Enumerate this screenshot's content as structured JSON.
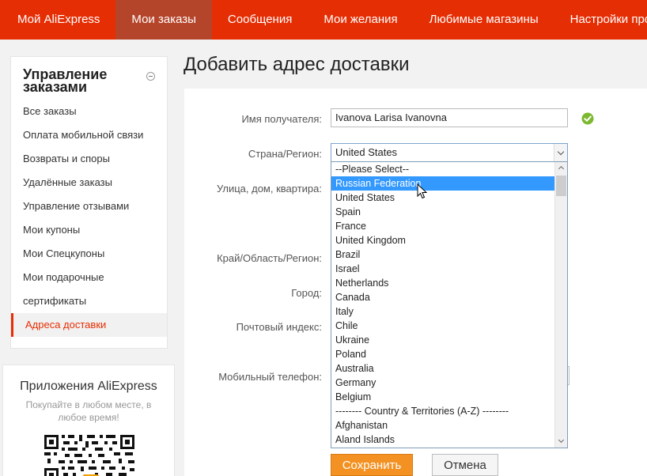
{
  "nav": {
    "tabs": [
      {
        "label": "Мой AliExpress"
      },
      {
        "label": "Мои заказы"
      },
      {
        "label": "Сообщения"
      },
      {
        "label": "Мои желания"
      },
      {
        "label": "Любимые магазины"
      },
      {
        "label": "Настройки профиля"
      }
    ],
    "active_index": 1
  },
  "sidebar": {
    "title": "Управление заказами",
    "items": [
      {
        "label": "Все заказы"
      },
      {
        "label": "Оплата мобильной связи"
      },
      {
        "label": "Возвраты и споры"
      },
      {
        "label": "Удалённые заказы"
      },
      {
        "label": "Управление отзывами"
      },
      {
        "label": "Мои купоны"
      },
      {
        "label": "Мои Спецкупоны"
      },
      {
        "label": "Мои подарочные"
      },
      {
        "label": "сертификаты"
      },
      {
        "label": "Адреса доставки"
      }
    ],
    "active_label": "Адреса доставки"
  },
  "apps": {
    "title": "Приложения AliExpress",
    "subtitle": "Покупайте в любом месте, в любое время!"
  },
  "page": {
    "title": "Добавить адрес доставки"
  },
  "form": {
    "labels": {
      "recipient": "Имя получателя:",
      "country": "Страна/Регион:",
      "street": "Улица, дом, квартира:",
      "region": "Край/Область/Регион:",
      "city": "Город:",
      "zip": "Почтовый индекс:",
      "phone": "Мобильный телефон:"
    },
    "recipient_value": "Ivanova Larisa Ivanovna",
    "country_selected": "United States",
    "country_options": [
      "--Please Select--",
      "Russian Federation",
      "United States",
      "Spain",
      "France",
      "United Kingdom",
      "Brazil",
      "Israel",
      "Netherlands",
      "Canada",
      "Italy",
      "Chile",
      "Ukraine",
      "Poland",
      "Australia",
      "Germany",
      "Belgium",
      "-------- Country & Territories (A-Z) --------",
      "Afghanistan",
      "Aland Islands"
    ],
    "highlighted_option": "Russian Federation",
    "save_label": "Сохранить",
    "cancel_label": "Отмена"
  },
  "colors": {
    "brand": "#e62e04",
    "active_tab": "#b5452a",
    "save_button": "#f39222",
    "highlight": "#3399ff",
    "ok": "#7cb82f"
  }
}
